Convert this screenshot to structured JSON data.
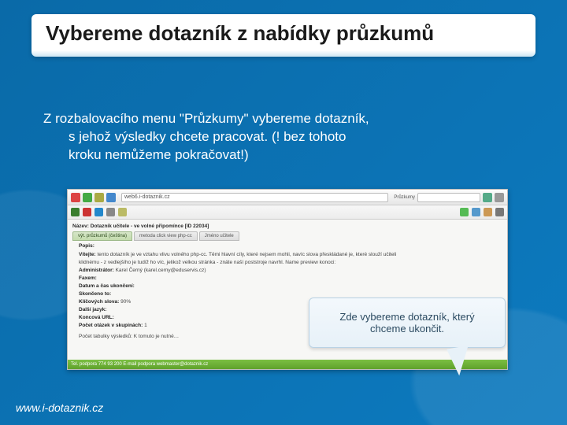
{
  "title": "Vybereme dotazník z nabídky průzkumů",
  "body": {
    "line1": "Z rozbalovacího menu \"Průzkumy\" vybereme dotazník,",
    "line2": "s jehož výsledky chcete pracovat. (! bez tohoto",
    "line3": "kroku  nemůžeme pokračovat!)"
  },
  "screenshot": {
    "url": "web6.i-dotaznik.cz",
    "search_placeholder": "",
    "header": "Název: Dotazník učitele - ve volné připomínce [ID 22034]",
    "tabs": [
      "výt. průzkumů (čeština)",
      "metoda click view php-cc",
      "Jméno učitele"
    ],
    "lines": [
      {
        "k": "Popis:",
        "v": ""
      },
      {
        "k": "Vítejte:",
        "v": "tento dotazník je ve vztahu vlivu volného php-cc. Těmi hlavní cíly, které nejsem mohli, navíc slova přeskládané je, které slouží učiteli"
      },
      {
        "k": "",
        "v": "klidnému - z vedlejšího je tudíž ho víc, jelikož velkou stránka - znáte naší poststroje navrhl. Name preview konoci:"
      },
      {
        "k": "Administrátor:",
        "v": "Karel Černý (karel.cerny@eduservis.cz)"
      },
      {
        "k": "Faxem:",
        "v": ""
      },
      {
        "k": "Datum a čas ukončení:",
        "v": ""
      },
      {
        "k": "Skončeno to:",
        "v": ""
      },
      {
        "k": "Klíčových slova:",
        "v": "90%"
      },
      {
        "k": "Další jazyk:",
        "v": ""
      },
      {
        "k": "Koncová URL:",
        "v": ""
      },
      {
        "k": "Počet otázek v skupinách:",
        "v": "1"
      }
    ],
    "footer_line": "Počet tabulky výsledků: K tomuto je nutné…",
    "status": "Tel. podpora 774  93 200    E-mail podpora webmaster@dotaznik.cz"
  },
  "callout": {
    "line1": "Zde vybereme dotazník, který",
    "line2": "chceme ukončit."
  },
  "footer": "www.i-dotaznik.cz"
}
